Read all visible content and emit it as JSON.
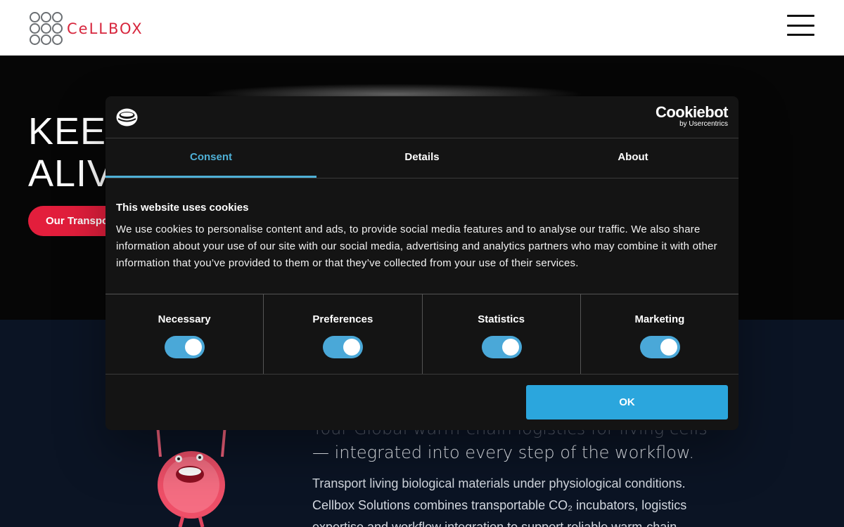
{
  "header": {
    "logo_text": "CeLLBOX",
    "menu_icon": "hamburger-menu-icon"
  },
  "hero": {
    "title_line1": "KEEP",
    "title_line2": "ALIVE",
    "cta_label": "Our Transport Solutions"
  },
  "content": {
    "tagline_faded": "Your Global warm-chain logistics for living cells",
    "tagline_main": "— integrated into every step of the workflow.",
    "body": "Transport living biological materials under physiological conditions. Cellbox Solutions combines transportable CO₂ incubators, logistics expertise and workflow integration to support reliable warm-chain"
  },
  "cookie_dialog": {
    "brand_name": "Cookiebot",
    "brand_sub": "by Usercentrics",
    "logo_icon": "cookiebot-logo-icon",
    "tabs": [
      {
        "label": "Consent",
        "active": true
      },
      {
        "label": "Details",
        "active": false
      },
      {
        "label": "About",
        "active": false
      }
    ],
    "heading": "This website uses cookies",
    "body": "We use cookies to personalise content and ads, to provide social media features and to analyse our traffic. We also share information about your use of our site with our social media, advertising and analytics partners who may combine it with other information that you’ve provided to them or that they’ve collected from your use of their services.",
    "categories": [
      {
        "label": "Necessary",
        "enabled": true
      },
      {
        "label": "Preferences",
        "enabled": true
      },
      {
        "label": "Statistics",
        "enabled": true
      },
      {
        "label": "Marketing",
        "enabled": true
      }
    ],
    "ok_label": "OK"
  },
  "colors": {
    "brand_red": "#e31e3c",
    "accent_blue": "#2ba6dd",
    "tab_active": "#4fb0d6",
    "dialog_bg": "#141414",
    "section_bg": "#0b1424"
  }
}
